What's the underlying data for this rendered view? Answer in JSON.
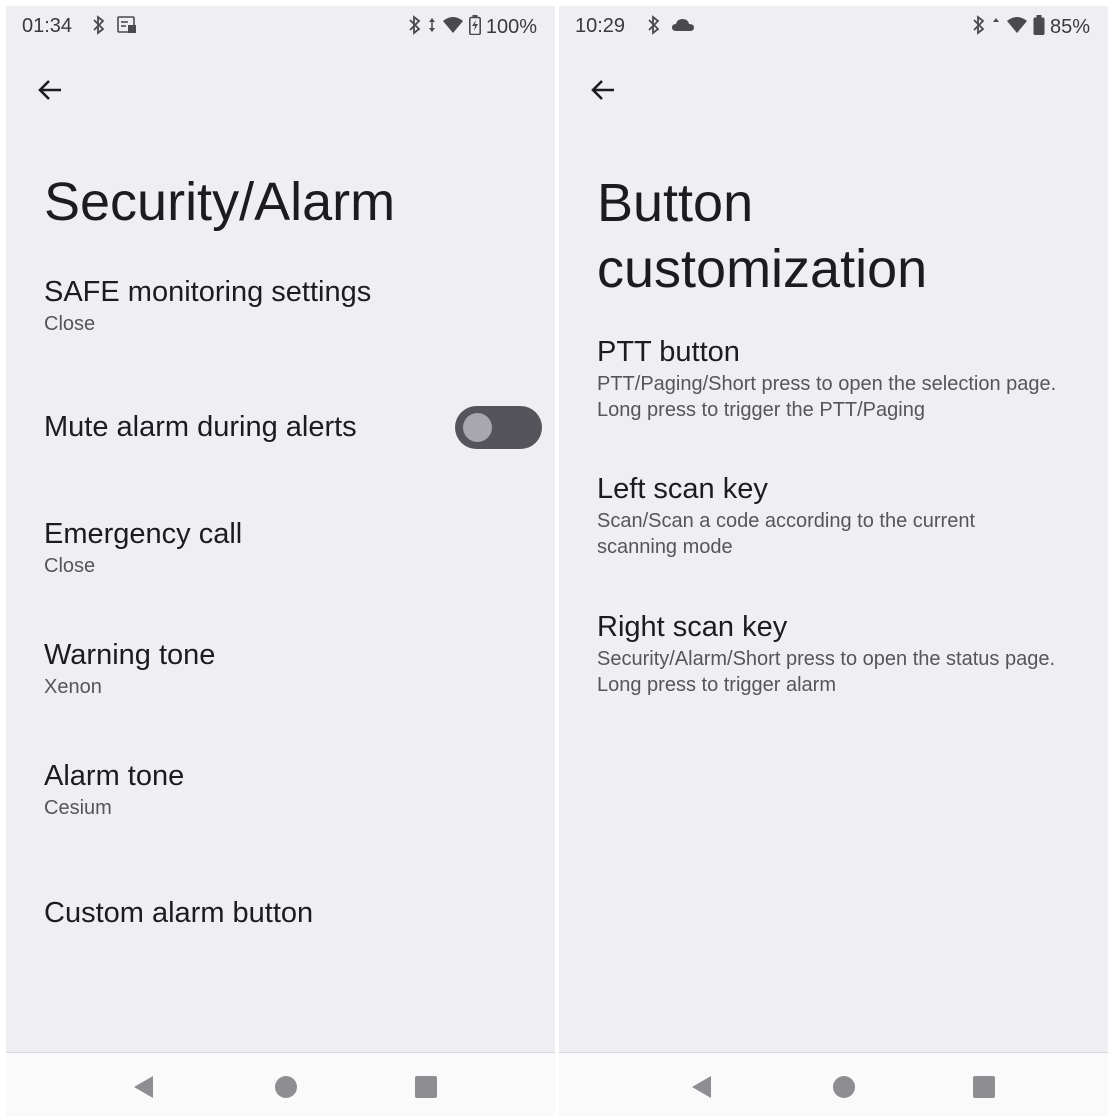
{
  "left": {
    "status": {
      "time": "01:34",
      "battery": "100%"
    },
    "title": "Security/Alarm",
    "items": [
      {
        "title": "SAFE monitoring settings",
        "summary": "Close"
      },
      {
        "title": "Mute alarm during alerts",
        "toggle_on": false
      },
      {
        "title": "Emergency call",
        "summary": "Close"
      },
      {
        "title": "Warning tone",
        "summary": "Xenon"
      },
      {
        "title": "Alarm tone",
        "summary": "Cesium"
      },
      {
        "title": "Custom alarm button"
      }
    ],
    "icons": [
      "bluetooth-icon",
      "screenshot-icon",
      "bluetooth-icon",
      "data-arrows-icon",
      "wifi-icon",
      "battery-charging-icon",
      "back-arrow-icon"
    ]
  },
  "right": {
    "status": {
      "time": "10:29",
      "battery": "85%"
    },
    "title": "Button customization",
    "items": [
      {
        "title": "PTT button",
        "summary": "PTT/Paging/Short press to open the selection page. Long press to trigger the PTT/Paging"
      },
      {
        "title": "Left scan key",
        "summary": "Scan/Scan a code according to the current scanning mode"
      },
      {
        "title": "Right scan key",
        "summary": "Security/Alarm/Short press to open the status page. Long press to trigger alarm"
      }
    ],
    "icons": [
      "bluetooth-icon",
      "cloud-icon",
      "bluetooth-icon",
      "data-arrows-icon",
      "wifi-icon",
      "battery-icon",
      "back-arrow-icon"
    ]
  },
  "navbar": {
    "icons": [
      "nav-back-icon",
      "nav-home-icon",
      "nav-recents-icon"
    ]
  },
  "colors": {
    "background": "#efeef2",
    "toggle_track": "#55545b",
    "toggle_thumb": "#a8a7ad",
    "text_primary": "#1c1b1f",
    "text_secondary": "#55555a"
  }
}
